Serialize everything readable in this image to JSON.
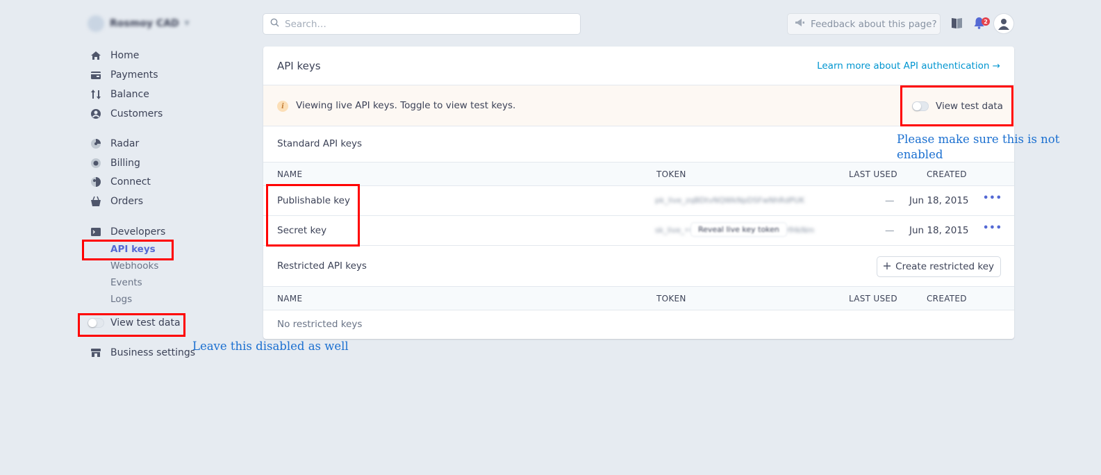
{
  "account": {
    "name": "Rosmoy CAD"
  },
  "sidebar": {
    "items": [
      {
        "label": "Home",
        "icon": "home-icon"
      },
      {
        "label": "Payments",
        "icon": "payments-icon"
      },
      {
        "label": "Balance",
        "icon": "balance-icon"
      },
      {
        "label": "Customers",
        "icon": "customers-icon"
      },
      {
        "label": "Radar",
        "icon": "radar-icon"
      },
      {
        "label": "Billing",
        "icon": "billing-icon"
      },
      {
        "label": "Connect",
        "icon": "connect-icon"
      },
      {
        "label": "Orders",
        "icon": "orders-icon"
      },
      {
        "label": "Developers",
        "icon": "terminal-icon"
      }
    ],
    "developers_sub": [
      "API keys",
      "Webhooks",
      "Events",
      "Logs"
    ],
    "view_test_data": "View test data",
    "business_settings": "Business settings"
  },
  "topbar": {
    "search_placeholder": "Search…",
    "feedback": "Feedback about this page?",
    "notifications_count": "2"
  },
  "page": {
    "title": "API keys",
    "learn_link": "Learn more about API authentication →",
    "notice": "Viewing live API keys. Toggle to view test keys.",
    "notice_toggle": "View test data",
    "standard": {
      "title": "Standard API keys",
      "columns": [
        "NAME",
        "TOKEN",
        "LAST USED",
        "CREATED"
      ],
      "rows": [
        {
          "name": "Publishable key",
          "token": "pk_live_zqBDtvNQWkNpDSFwNhRdPUK",
          "last_used": "—",
          "created": "Jun 18, 2015",
          "more": "•••"
        },
        {
          "name": "Secret key",
          "token": "sk_live_•••••••••••••••••••••••fHkNm",
          "reveal": "Reveal live key token",
          "last_used": "—",
          "created": "Jun 18, 2015",
          "more": "•••"
        }
      ]
    },
    "restricted": {
      "title": "Restricted API keys",
      "create_button": "Create restricted key",
      "columns": [
        "NAME",
        "TOKEN",
        "LAST USED",
        "CREATED"
      ],
      "empty": "No restricted keys"
    }
  },
  "annotations": {
    "top_note": "Please make sure this is not enabled",
    "sidebar_note": "Leave this disabled as well",
    "color": "#ff0000"
  },
  "colors": {
    "accent": "#5469d4",
    "link": "#0095d0",
    "background": "#e6ebf1"
  }
}
